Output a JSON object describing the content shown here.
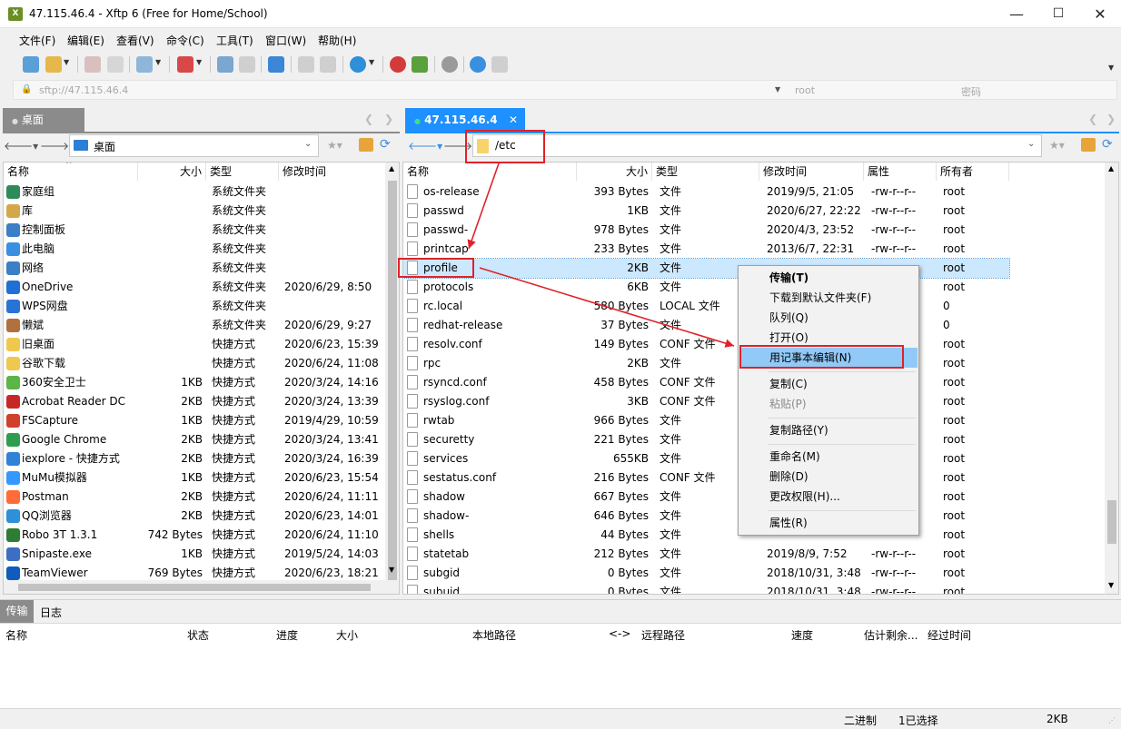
{
  "window": {
    "title": "47.115.46.4 - Xftp 6 (Free for Home/School)",
    "app_icon": "xftp-icon"
  },
  "menu": [
    "文件(F)",
    "编辑(E)",
    "查看(V)",
    "命令(C)",
    "工具(T)",
    "窗口(W)",
    "帮助(H)"
  ],
  "address": {
    "url": "sftp://47.115.46.4",
    "user_placeholder": "root",
    "password_placeholder": "密码"
  },
  "left": {
    "tab": "桌面",
    "path": "桌面",
    "headers": [
      "名称",
      "大小",
      "类型",
      "修改时间"
    ],
    "rows": [
      {
        "name": "家庭组",
        "size": "",
        "type": "系统文件夹",
        "date": "",
        "icon": "homegroup-icon"
      },
      {
        "name": "库",
        "size": "",
        "type": "系统文件夹",
        "date": "",
        "icon": "library-icon"
      },
      {
        "name": "控制面板",
        "size": "",
        "type": "系统文件夹",
        "date": "",
        "icon": "control-panel-icon"
      },
      {
        "name": "此电脑",
        "size": "",
        "type": "系统文件夹",
        "date": "",
        "icon": "computer-icon"
      },
      {
        "name": "网络",
        "size": "",
        "type": "系统文件夹",
        "date": "",
        "icon": "network-icon"
      },
      {
        "name": "OneDrive",
        "size": "",
        "type": "系统文件夹",
        "date": "2020/6/29, 8:50",
        "icon": "onedrive-icon"
      },
      {
        "name": "WPS网盘",
        "size": "",
        "type": "系统文件夹",
        "date": "",
        "icon": "wps-cloud-icon"
      },
      {
        "name": "懒斌",
        "size": "",
        "type": "系统文件夹",
        "date": "2020/6/29, 9:27",
        "icon": "user-icon"
      },
      {
        "name": "旧桌面",
        "size": "",
        "type": "快捷方式",
        "date": "2020/6/23, 15:39",
        "icon": "folder-icon"
      },
      {
        "name": "谷歌下载",
        "size": "",
        "type": "快捷方式",
        "date": "2020/6/24, 11:08",
        "icon": "folder-icon"
      },
      {
        "name": "360安全卫士",
        "size": "1KB",
        "type": "快捷方式",
        "date": "2020/3/24, 14:16",
        "icon": "360-icon"
      },
      {
        "name": "Acrobat Reader DC",
        "size": "2KB",
        "type": "快捷方式",
        "date": "2020/3/24, 13:39",
        "icon": "acrobat-icon"
      },
      {
        "name": "FSCapture",
        "size": "1KB",
        "type": "快捷方式",
        "date": "2019/4/29, 10:59",
        "icon": "fscapture-icon"
      },
      {
        "name": "Google Chrome",
        "size": "2KB",
        "type": "快捷方式",
        "date": "2020/3/24, 13:41",
        "icon": "chrome-icon"
      },
      {
        "name": "iexplore - 快捷方式",
        "size": "2KB",
        "type": "快捷方式",
        "date": "2020/3/24, 16:39",
        "icon": "ie-icon"
      },
      {
        "name": "MuMu模拟器",
        "size": "1KB",
        "type": "快捷方式",
        "date": "2020/6/23, 15:54",
        "icon": "mumu-icon"
      },
      {
        "name": "Postman",
        "size": "2KB",
        "type": "快捷方式",
        "date": "2020/6/24, 11:11",
        "icon": "postman-icon"
      },
      {
        "name": "QQ浏览器",
        "size": "2KB",
        "type": "快捷方式",
        "date": "2020/6/23, 14:01",
        "icon": "qq-browser-icon"
      },
      {
        "name": "Robo 3T 1.3.1",
        "size": "742 Bytes",
        "type": "快捷方式",
        "date": "2020/6/24, 11:10",
        "icon": "robo3t-icon"
      },
      {
        "name": "Snipaste.exe",
        "size": "1KB",
        "type": "快捷方式",
        "date": "2019/5/24, 14:03",
        "icon": "snipaste-icon"
      },
      {
        "name": "TeamViewer",
        "size": "769 Bytes",
        "type": "快捷方式",
        "date": "2020/6/23, 18:21",
        "icon": "teamviewer-icon"
      }
    ]
  },
  "right": {
    "tab": "47.115.46.4",
    "path": "/etc",
    "headers": [
      "名称",
      "大小",
      "类型",
      "修改时间",
      "属性",
      "所有者"
    ],
    "rows": [
      {
        "name": "os-release",
        "size": "393 Bytes",
        "type": "文件",
        "date": "2019/9/5, 21:05",
        "attr": "-rw-r--r--",
        "owner": "root"
      },
      {
        "name": "passwd",
        "size": "1KB",
        "type": "文件",
        "date": "2020/6/27, 22:22",
        "attr": "-rw-r--r--",
        "owner": "root"
      },
      {
        "name": "passwd-",
        "size": "978 Bytes",
        "type": "文件",
        "date": "2020/4/3, 23:52",
        "attr": "-rw-r--r--",
        "owner": "root"
      },
      {
        "name": "printcap",
        "size": "233 Bytes",
        "type": "文件",
        "date": "2013/6/7, 22:31",
        "attr": "-rw-r--r--",
        "owner": "root"
      },
      {
        "name": "profile",
        "size": "2KB",
        "type": "文件",
        "date": "",
        "attr": "",
        "owner": "root"
      },
      {
        "name": "protocols",
        "size": "6KB",
        "type": "文件",
        "date": "",
        "attr": "",
        "owner": "root"
      },
      {
        "name": "rc.local",
        "size": "580 Bytes",
        "type": "LOCAL 文件",
        "date": "",
        "attr": "",
        "owner": "0"
      },
      {
        "name": "redhat-release",
        "size": "37 Bytes",
        "type": "文件",
        "date": "",
        "attr": "",
        "owner": "0"
      },
      {
        "name": "resolv.conf",
        "size": "149 Bytes",
        "type": "CONF 文件",
        "date": "",
        "attr": "",
        "owner": "root"
      },
      {
        "name": "rpc",
        "size": "2KB",
        "type": "文件",
        "date": "",
        "attr": "",
        "owner": "root"
      },
      {
        "name": "rsyncd.conf",
        "size": "458 Bytes",
        "type": "CONF 文件",
        "date": "",
        "attr": "",
        "owner": "root"
      },
      {
        "name": "rsyslog.conf",
        "size": "3KB",
        "type": "CONF 文件",
        "date": "",
        "attr": "",
        "owner": "root"
      },
      {
        "name": "rwtab",
        "size": "966 Bytes",
        "type": "文件",
        "date": "",
        "attr": "",
        "owner": "root"
      },
      {
        "name": "securetty",
        "size": "221 Bytes",
        "type": "文件",
        "date": "",
        "attr": "",
        "owner": "root"
      },
      {
        "name": "services",
        "size": "655KB",
        "type": "文件",
        "date": "",
        "attr": "",
        "owner": "root"
      },
      {
        "name": "sestatus.conf",
        "size": "216 Bytes",
        "type": "CONF 文件",
        "date": "",
        "attr": "",
        "owner": "root"
      },
      {
        "name": "shadow",
        "size": "667 Bytes",
        "type": "文件",
        "date": "",
        "attr": "",
        "owner": "root"
      },
      {
        "name": "shadow-",
        "size": "646 Bytes",
        "type": "文件",
        "date": "",
        "attr": "",
        "owner": "root"
      },
      {
        "name": "shells",
        "size": "44 Bytes",
        "type": "文件",
        "date": "",
        "attr": "",
        "owner": "root"
      },
      {
        "name": "statetab",
        "size": "212 Bytes",
        "type": "文件",
        "date": "2019/8/9, 7:52",
        "attr": "-rw-r--r--",
        "owner": "root"
      },
      {
        "name": "subgid",
        "size": "0 Bytes",
        "type": "文件",
        "date": "2018/10/31, 3:48",
        "attr": "-rw-r--r--",
        "owner": "root"
      },
      {
        "name": "subuid",
        "size": "0 Bytes",
        "type": "文件",
        "date": "2018/10/31, 3:48",
        "attr": "-rw-r--r--",
        "owner": "root"
      }
    ],
    "selected_index": 4
  },
  "context_menu": {
    "items": [
      "传输(T)",
      "下载到默认文件夹(F)",
      "队列(Q)",
      "打开(O)",
      "用记事本编辑(N)",
      "复制(C)",
      "粘贴(P)",
      "复制路径(Y)",
      "重命名(M)",
      "删除(D)",
      "更改权限(H)...",
      "属性(R)"
    ],
    "highlighted": "用记事本编辑(N)"
  },
  "bottom": {
    "tabs": [
      "传输",
      "日志"
    ],
    "headers": [
      "名称",
      "状态",
      "进度",
      "大小",
      "本地路径",
      "<->",
      "远程路径",
      "速度",
      "估计剩余...",
      "经过时间"
    ]
  },
  "status": {
    "mode": "二进制",
    "selection": "1已选择",
    "size": "2KB"
  },
  "colors": {
    "accent": "#1e90ff",
    "highlight": "#cce8ff",
    "menu_highlight": "#91c9f7",
    "annotation": "#e0222a"
  }
}
